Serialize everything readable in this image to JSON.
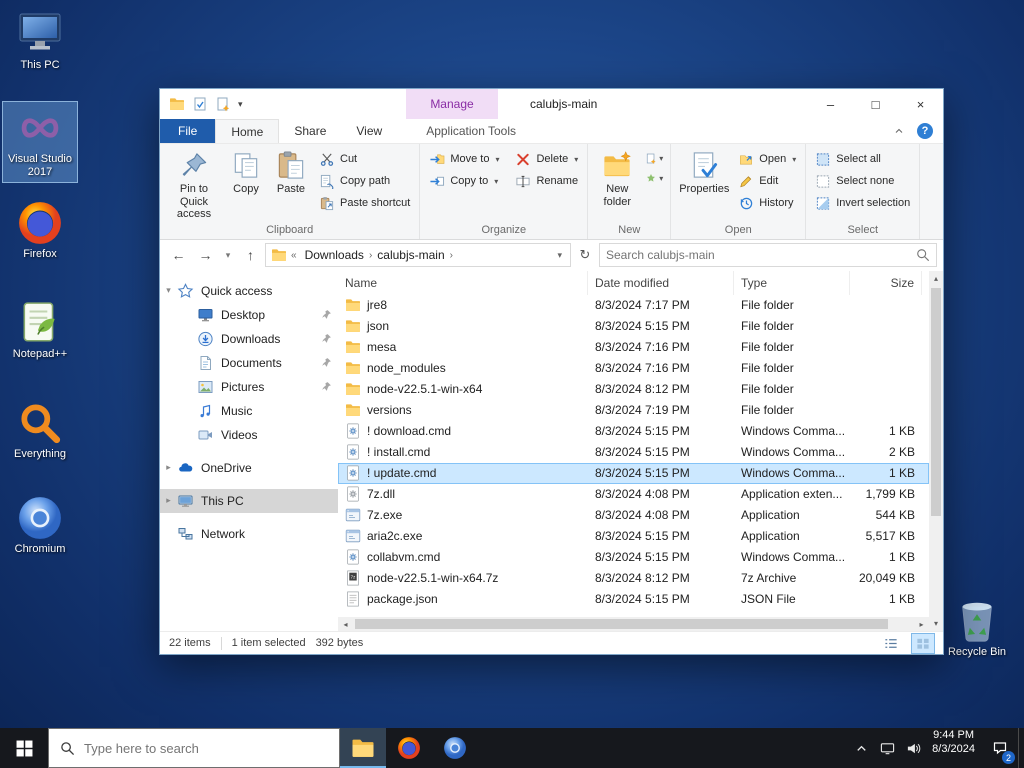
{
  "colors": {
    "sel": "#cce8ff",
    "manage_bg": "#f1ddf6",
    "manage_fg": "#8a2da5",
    "file_tab_bg": "#1f5cab",
    "taskbar_bg": "#16181d"
  },
  "desktop": {
    "icons": [
      {
        "id": "this-pc",
        "label": "This PC",
        "selected": false
      },
      {
        "id": "visual-studio",
        "label": "Visual Studio 2017",
        "selected": true
      },
      {
        "id": "firefox",
        "label": "Firefox",
        "selected": false
      },
      {
        "id": "notepad-plus-plus",
        "label": "Notepad++",
        "selected": false
      },
      {
        "id": "everything",
        "label": "Everything",
        "selected": false
      },
      {
        "id": "chromium",
        "label": "Chromium",
        "selected": false
      }
    ],
    "recycle_bin": {
      "label": "Recycle Bin"
    }
  },
  "explorer": {
    "titlebar": {
      "contextual_tab": "Manage",
      "title": "calubjs-main"
    },
    "tabs": {
      "file": "File",
      "home": "Home",
      "share": "Share",
      "view": "View",
      "contextual": "Application Tools"
    },
    "ribbon": {
      "clipboard": {
        "label": "Clipboard",
        "pin": "Pin to Quick access",
        "copy": "Copy",
        "paste": "Paste",
        "cut": "Cut",
        "copy_path": "Copy path",
        "paste_shortcut": "Paste shortcut"
      },
      "organize": {
        "label": "Organize",
        "move_to": "Move to",
        "copy_to": "Copy to",
        "delete": "Delete",
        "rename": "Rename"
      },
      "new_group": {
        "label": "New",
        "new_folder": "New folder"
      },
      "open_group": {
        "label": "Open",
        "properties": "Properties",
        "open": "Open",
        "edit": "Edit",
        "history": "History"
      },
      "select_group": {
        "label": "Select",
        "select_all": "Select all",
        "select_none": "Select none",
        "invert": "Invert selection"
      }
    },
    "addressbar": {
      "root_ellipsis": "«",
      "crumbs": [
        "Downloads",
        "calubjs-main"
      ],
      "search_placeholder": "Search calubjs-main"
    },
    "sidebar": [
      {
        "id": "quick-access",
        "label": "Quick access",
        "icon": "star",
        "level": 0,
        "chevron": "down",
        "pinned": false,
        "selected": false,
        "gap_before": false
      },
      {
        "id": "desktop",
        "label": "Desktop",
        "icon": "desktop",
        "level": 1,
        "chevron": null,
        "pinned": true,
        "selected": false,
        "gap_before": false
      },
      {
        "id": "downloads",
        "label": "Downloads",
        "icon": "downloads",
        "level": 1,
        "chevron": null,
        "pinned": true,
        "selected": false,
        "gap_before": false
      },
      {
        "id": "documents",
        "label": "Documents",
        "icon": "documents",
        "level": 1,
        "chevron": null,
        "pinned": true,
        "selected": false,
        "gap_before": false
      },
      {
        "id": "pictures",
        "label": "Pictures",
        "icon": "pictures",
        "level": 1,
        "chevron": null,
        "pinned": true,
        "selected": false,
        "gap_before": false
      },
      {
        "id": "music",
        "label": "Music",
        "icon": "music",
        "level": 1,
        "chevron": null,
        "pinned": false,
        "selected": false,
        "gap_before": false
      },
      {
        "id": "videos",
        "label": "Videos",
        "icon": "videos",
        "level": 1,
        "chevron": null,
        "pinned": false,
        "selected": false,
        "gap_before": false
      },
      {
        "id": "onedrive",
        "label": "OneDrive",
        "icon": "onedrive",
        "level": 0,
        "chevron": "right",
        "pinned": false,
        "selected": false,
        "gap_before": true
      },
      {
        "id": "this-pc",
        "label": "This PC",
        "icon": "thispc",
        "level": 0,
        "chevron": "right",
        "pinned": false,
        "selected": true,
        "gap_before": true
      },
      {
        "id": "network",
        "label": "Network",
        "icon": "network",
        "level": 0,
        "chevron": null,
        "pinned": false,
        "selected": false,
        "gap_before": true
      }
    ],
    "list": {
      "columns": [
        {
          "id": "name",
          "label": "Name"
        },
        {
          "id": "date",
          "label": "Date modified"
        },
        {
          "id": "type",
          "label": "Type"
        },
        {
          "id": "size",
          "label": "Size"
        }
      ],
      "files": [
        {
          "name": "jre8",
          "date": "8/3/2024 7:17 PM",
          "type": "File folder",
          "size": "",
          "icon": "folder",
          "selected": false
        },
        {
          "name": "json",
          "date": "8/3/2024 5:15 PM",
          "type": "File folder",
          "size": "",
          "icon": "folder",
          "selected": false
        },
        {
          "name": "mesa",
          "date": "8/3/2024 7:16 PM",
          "type": "File folder",
          "size": "",
          "icon": "folder",
          "selected": false
        },
        {
          "name": "node_modules",
          "date": "8/3/2024 7:16 PM",
          "type": "File folder",
          "size": "",
          "icon": "folder",
          "selected": false
        },
        {
          "name": "node-v22.5.1-win-x64",
          "date": "8/3/2024 8:12 PM",
          "type": "File folder",
          "size": "",
          "icon": "folder",
          "selected": false
        },
        {
          "name": "versions",
          "date": "8/3/2024 7:19 PM",
          "type": "File folder",
          "size": "",
          "icon": "folder",
          "selected": false
        },
        {
          "name": "! download.cmd",
          "date": "8/3/2024 5:15 PM",
          "type": "Windows Comma...",
          "size": "1 KB",
          "icon": "cmd",
          "selected": false
        },
        {
          "name": "! install.cmd",
          "date": "8/3/2024 5:15 PM",
          "type": "Windows Comma...",
          "size": "2 KB",
          "icon": "cmd",
          "selected": false
        },
        {
          "name": "! update.cmd",
          "date": "8/3/2024 5:15 PM",
          "type": "Windows Comma...",
          "size": "1 KB",
          "icon": "cmd",
          "selected": true
        },
        {
          "name": "7z.dll",
          "date": "8/3/2024 4:08 PM",
          "type": "Application exten...",
          "size": "1,799 KB",
          "icon": "dll",
          "selected": false
        },
        {
          "name": "7z.exe",
          "date": "8/3/2024 4:08 PM",
          "type": "Application",
          "size": "544 KB",
          "icon": "exe",
          "selected": false
        },
        {
          "name": "aria2c.exe",
          "date": "8/3/2024 5:15 PM",
          "type": "Application",
          "size": "5,517 KB",
          "icon": "exe",
          "selected": false
        },
        {
          "name": "collabvm.cmd",
          "date": "8/3/2024 5:15 PM",
          "type": "Windows Comma...",
          "size": "1 KB",
          "icon": "cmd",
          "selected": false
        },
        {
          "name": "node-v22.5.1-win-x64.7z",
          "date": "8/3/2024 8:12 PM",
          "type": "7z Archive",
          "size": "20,049 KB",
          "icon": "sevenzip",
          "selected": false
        },
        {
          "name": "package.json",
          "date": "8/3/2024 5:15 PM",
          "type": "JSON File",
          "size": "1 KB",
          "icon": "jsonfile",
          "selected": false
        }
      ]
    },
    "statusbar": {
      "count": "22 items",
      "selection": "1 item selected",
      "selection_size": "392 bytes"
    }
  },
  "taskbar": {
    "search_placeholder": "Type here to search",
    "clock": {
      "time": "9:44 PM",
      "date": "8/3/2024"
    },
    "badge": "2"
  }
}
